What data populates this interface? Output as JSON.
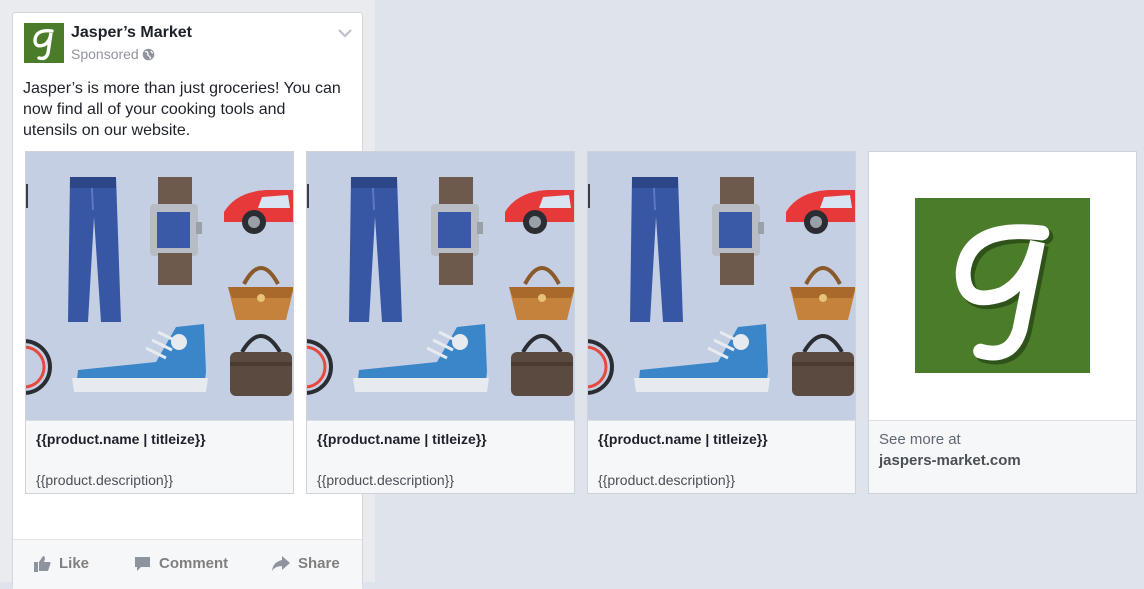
{
  "post": {
    "page_name": "Jasper’s Market",
    "sponsored_label": "Sponsored",
    "body_text": "Jasper’s is more than just groceries! You can now find all of your cooking tools and utensils on our website."
  },
  "carousel": {
    "cards": [
      {
        "name": "{{product.name | titleize}}",
        "description": "{{product.description}}"
      },
      {
        "name": "{{product.name | titleize}}",
        "description": "{{product.description}}"
      },
      {
        "name": "{{product.name | titleize}}",
        "description": "{{product.description}}"
      }
    ],
    "end_card": {
      "see_more_label": "See more at",
      "domain": "jaspers-market.com"
    }
  },
  "actions": {
    "like_label": "Like",
    "comment_label": "Comment",
    "share_label": "Share"
  },
  "icons": {
    "brand_logo": "script-j-logo",
    "audience": "globe-icon",
    "menu": "chevron-down-icon",
    "like": "thumbs-up-icon",
    "comment": "comment-icon",
    "share": "share-arrow-icon"
  },
  "colors": {
    "brand_green": "#4b7c2a",
    "card_image_bg": "#c4cfe4",
    "page_bg": "#dfe3ec"
  }
}
